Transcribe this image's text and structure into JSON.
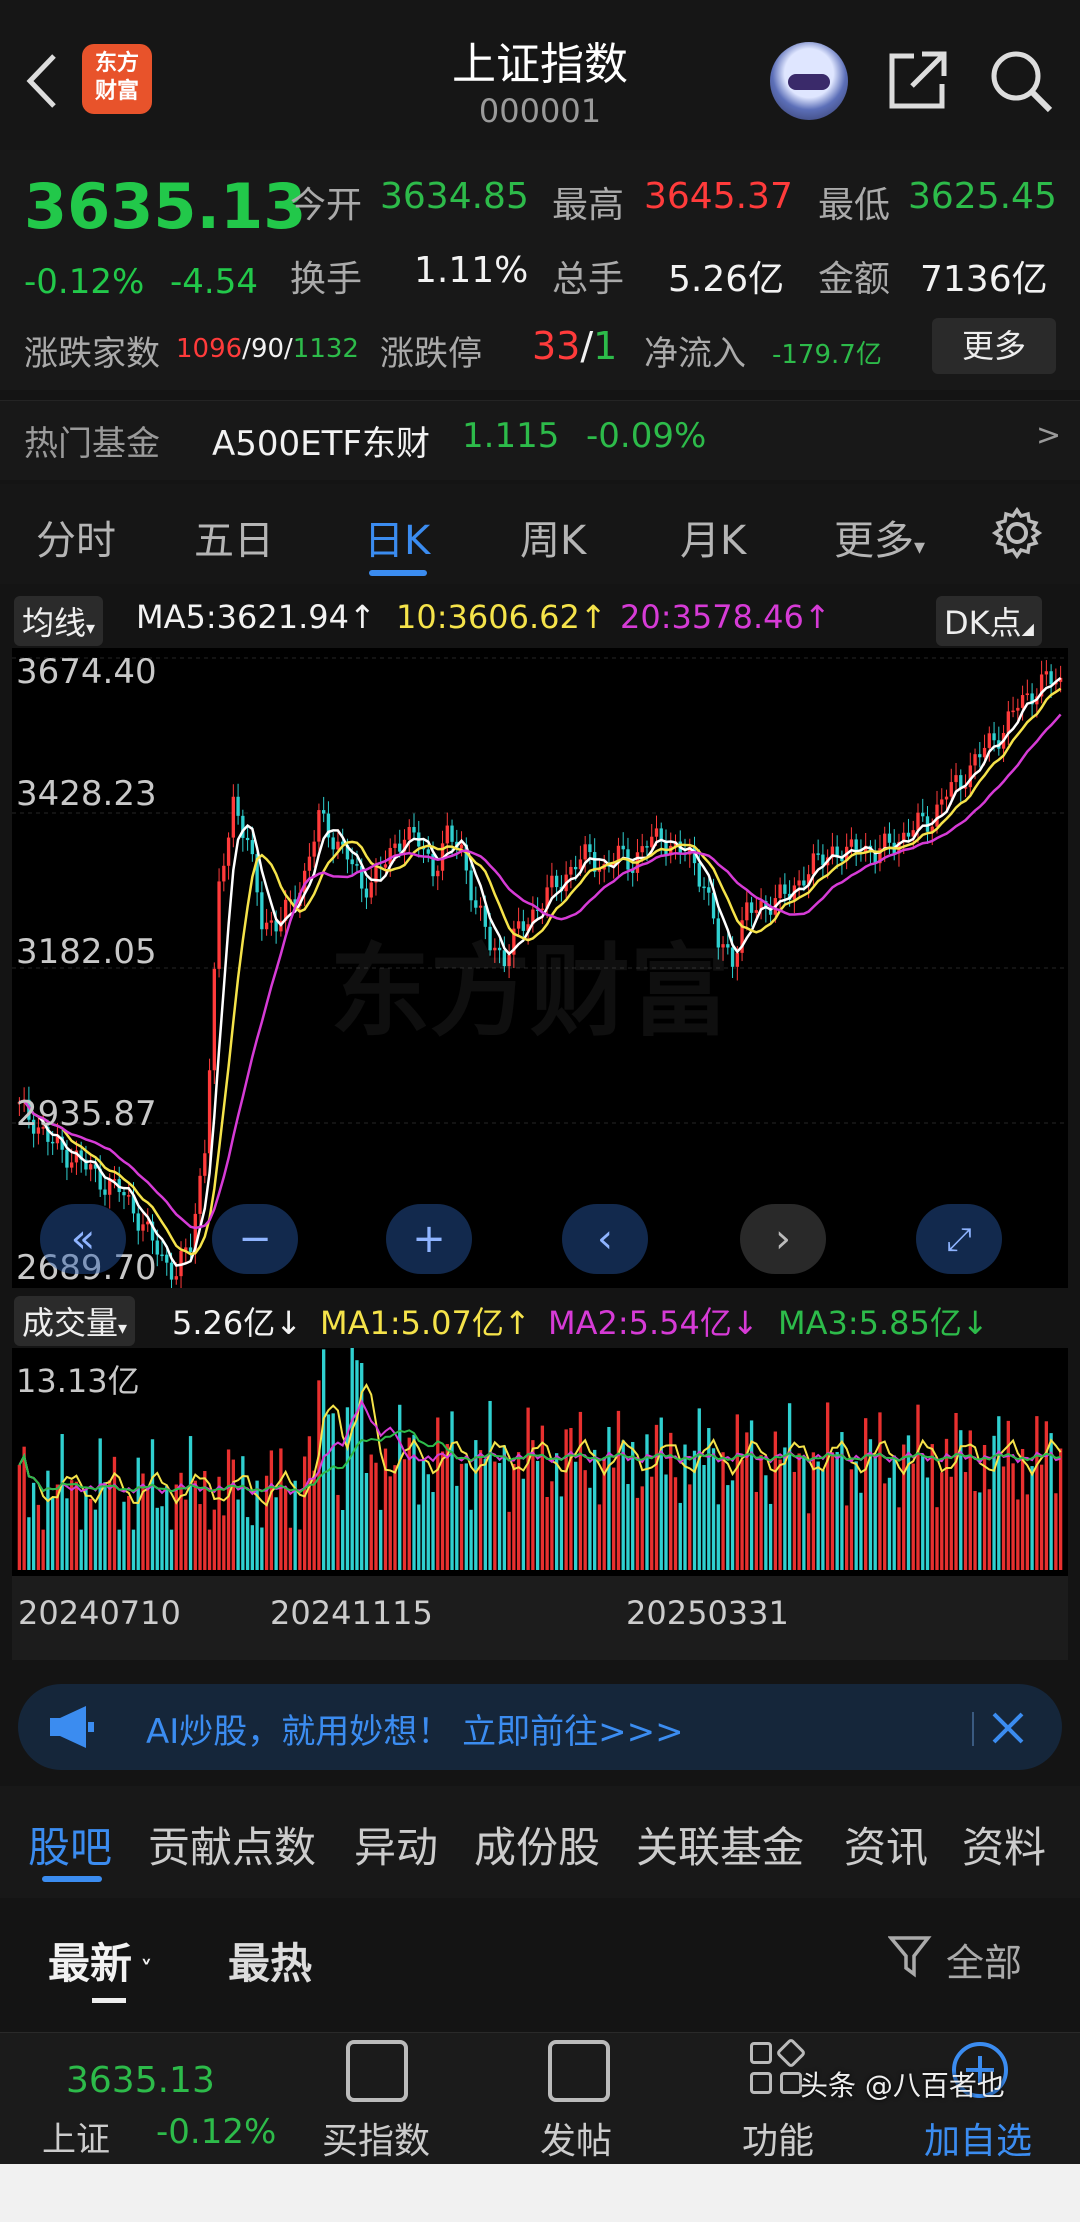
{
  "header": {
    "title": "上证指数",
    "code": "000001",
    "logo_line1": "东方",
    "logo_line2": "财富"
  },
  "quote": {
    "price": "3635.13",
    "change_pct": "-0.12%",
    "change": "-4.54",
    "open_label": "今开",
    "open": "3634.85",
    "high_label": "最高",
    "high": "3645.37",
    "low_label": "最低",
    "low": "3625.45",
    "turnover_label": "换手",
    "turnover": "1.11%",
    "volume_label": "总手",
    "volume": "5.26亿",
    "amount_label": "金额",
    "amount": "7136亿",
    "breadth_label": "涨跌家数",
    "up": "1096",
    "flat": "90",
    "down": "1132",
    "limit_label": "涨跌停",
    "limit_up": "33",
    "limit_down": "1",
    "netflow_label": "净流入",
    "netflow": "-179.7亿",
    "more_label": "更多"
  },
  "fund": {
    "label": "热门基金",
    "name": "A500ETF东财",
    "price": "1.115",
    "change": "-0.09%",
    "arrow": ">"
  },
  "kline_tabs": [
    "分时",
    "五日",
    "日K",
    "周K",
    "月K",
    "更多"
  ],
  "active_kline_tab": "日K",
  "ma_legend": {
    "selector": "均线",
    "ma5": "MA5:3621.94",
    "ma10": "10:3606.62",
    "ma20": "20:3578.46",
    "dk_label": "DK点"
  },
  "y_axis_labels": [
    "3674.40",
    "3428.23",
    "3182.05",
    "2935.87",
    "2689.70"
  ],
  "watermark": "东方财富",
  "volume_legend": {
    "selector": "成交量",
    "vol": "5.26亿",
    "ma1": "MA1:5.07亿",
    "ma2": "MA2:5.54亿",
    "ma3": "MA3:5.85亿",
    "max_label": "13.13亿"
  },
  "date_labels": [
    "20240710",
    "20241115",
    "20250331"
  ],
  "ai_banner": {
    "text": "AI炒股，就用妙想！ 立即前往>>>"
  },
  "section_tabs": [
    "股吧",
    "贡献点数",
    "异动",
    "成份股",
    "关联基金",
    "资讯",
    "资料"
  ],
  "feed_filters": {
    "latest": "最新",
    "hot": "最热",
    "all": "全部"
  },
  "bottom_nav": {
    "index_price": "3635.13",
    "index_name": "上证",
    "index_change": "-0.12%",
    "items": [
      "买指数",
      "发帖",
      "功能",
      "加自选"
    ]
  },
  "credit": "头条 @八百者也",
  "colors": {
    "up": "#ff3b3b",
    "down": "#2dbb4a",
    "accent": "#3b8cf0",
    "ma5": "#ffffff",
    "ma10": "#f5e34a",
    "ma20": "#d63bd6"
  },
  "chart_data": {
    "type": "candlestick",
    "price_axis": [
      2689.7,
      3674.4
    ],
    "close_path": [
      2960,
      2940,
      2910,
      2890,
      2880,
      2860,
      2840,
      2830,
      2800,
      2760,
      2720,
      2700,
      2740,
      2900,
      3300,
      3450,
      3380,
      3260,
      3250,
      3280,
      3330,
      3420,
      3390,
      3360,
      3310,
      3330,
      3360,
      3400,
      3380,
      3340,
      3390,
      3370,
      3280,
      3220,
      3200,
      3240,
      3270,
      3300,
      3320,
      3350,
      3360,
      3340,
      3360,
      3350,
      3380,
      3390,
      3370,
      3360,
      3320,
      3220,
      3200,
      3270,
      3280,
      3290,
      3300,
      3330,
      3350,
      3370,
      3360,
      3380,
      3360,
      3380,
      3390,
      3410,
      3420,
      3460,
      3480,
      3510,
      3540,
      3560,
      3600,
      3620,
      3640,
      3635
    ]
  }
}
